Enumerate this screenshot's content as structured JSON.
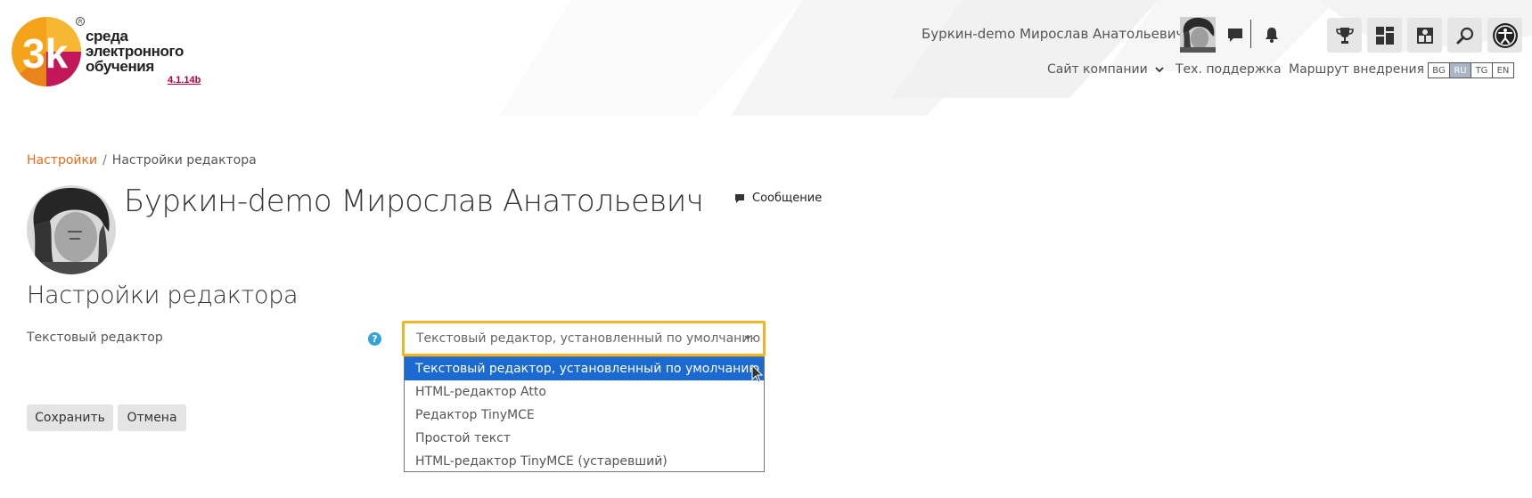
{
  "logo": {
    "line1": "среда",
    "line2": "электронного",
    "line3": "обучения",
    "version": "4.1.14b",
    "glyph": "3k"
  },
  "header": {
    "user_name": "Буркин-demo Мирослав Анатольевич",
    "icons": [
      "chat-icon",
      "bell-icon"
    ],
    "tools": [
      "trophy-icon",
      "dashboard-icon",
      "puzzle-icon",
      "search-icon",
      "accessibility-icon"
    ],
    "nav": {
      "company_site": "Сайт компании",
      "support": "Тех. поддержка",
      "route": "Маршрут внедрения"
    },
    "languages": [
      {
        "code": "BG",
        "active": false
      },
      {
        "code": "RU",
        "active": true
      },
      {
        "code": "TG",
        "active": false
      },
      {
        "code": "EN",
        "active": false
      }
    ]
  },
  "breadcrumb": {
    "root": "Настройки",
    "separator": "/",
    "current": "Настройки редактора"
  },
  "profile": {
    "name": "Буркин-demo Мирослав Анатольевич",
    "message_label": "Сообщение"
  },
  "page": {
    "heading": "Настройки редактора"
  },
  "form": {
    "editor_label": "Текстовый редактор",
    "help_icon": "?",
    "select_value": "Текстовый редактор, установленный по умолчанию",
    "options": [
      "Текстовый редактор, установленный по умолчанию",
      "HTML-редактор Atto",
      "Редактор TinyMCE",
      "Простой текст",
      "HTML-редактор TinyMCE (устаревший)"
    ],
    "selected_index": 0,
    "save_label": "Сохранить",
    "cancel_label": "Отмена"
  },
  "colors": {
    "accent_orange": "#e86a1b",
    "focus_yellow": "#f0b429",
    "selection_blue": "#1a6ad1",
    "help_blue": "#35a3d6"
  }
}
